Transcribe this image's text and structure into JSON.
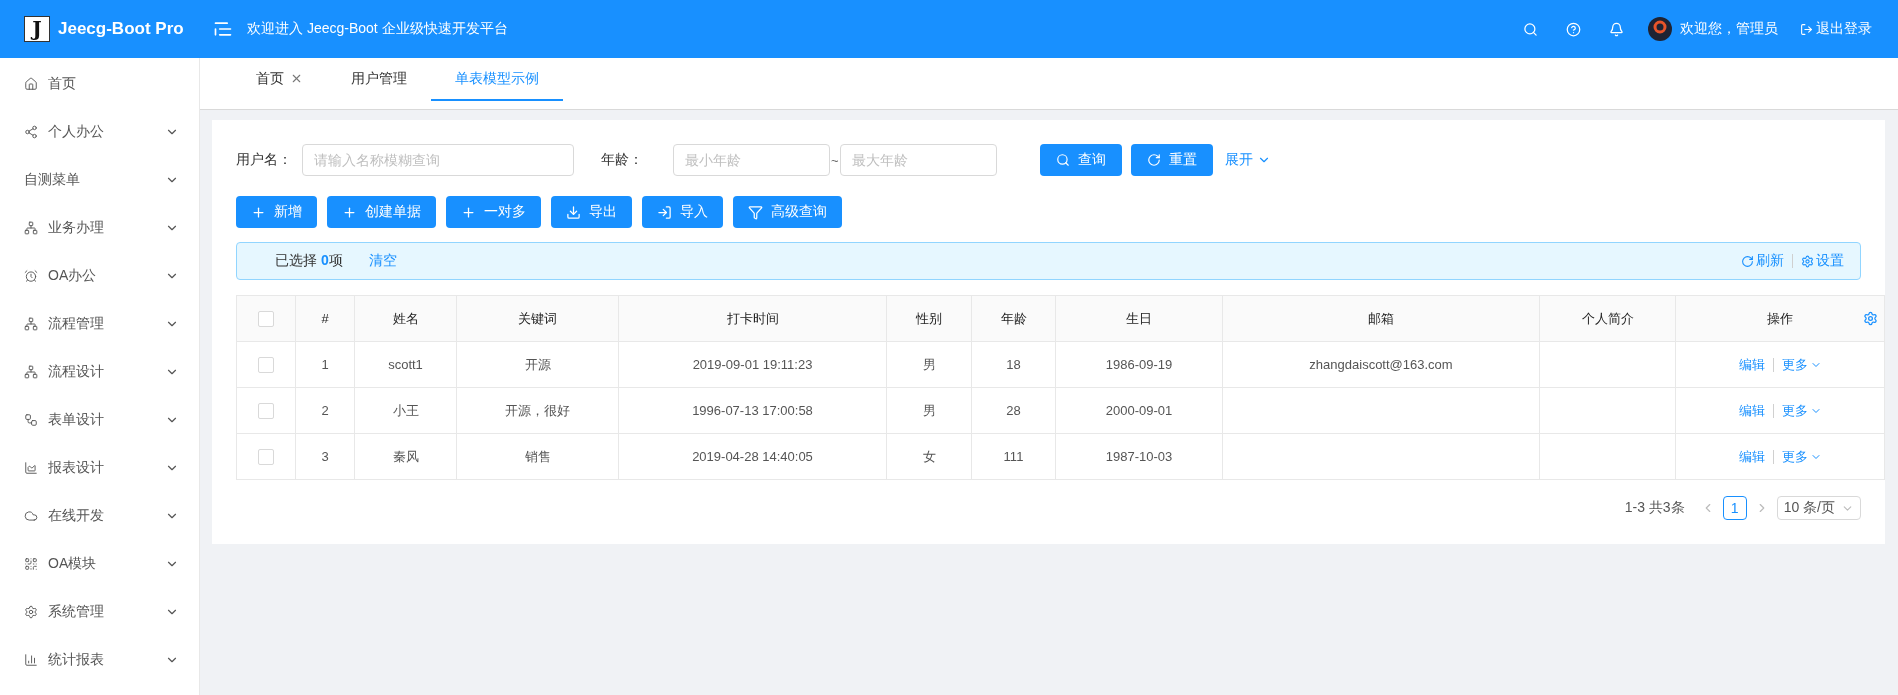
{
  "header": {
    "logo_mark": "J",
    "logo_text": "Jeecg-Boot Pro",
    "welcome": "欢迎进入 Jeecg-Boot 企业级快速开发平台",
    "user_name": "欢迎您，管理员",
    "logout": "退出登录"
  },
  "sidebar": {
    "items": [
      {
        "label": "首页",
        "kind": "home",
        "expandable": false
      },
      {
        "label": "个人办公",
        "kind": "share",
        "expandable": true
      },
      {
        "label": "自测菜单",
        "kind": "plain",
        "expandable": true
      },
      {
        "label": "业务办理",
        "kind": "sitemap",
        "expandable": true
      },
      {
        "label": "OA办公",
        "kind": "alarm",
        "expandable": true
      },
      {
        "label": "流程管理",
        "kind": "sitemap",
        "expandable": true
      },
      {
        "label": "流程设计",
        "kind": "sitemap",
        "expandable": true
      },
      {
        "label": "表单设计",
        "kind": "cluster",
        "expandable": true
      },
      {
        "label": "报表设计",
        "kind": "area",
        "expandable": true
      },
      {
        "label": "在线开发",
        "kind": "cloud",
        "expandable": true
      },
      {
        "label": "OA模块",
        "kind": "qrcode",
        "expandable": true
      },
      {
        "label": "系统管理",
        "kind": "gear",
        "expandable": true
      },
      {
        "label": "统计报表",
        "kind": "bar",
        "expandable": true
      }
    ]
  },
  "tabs": [
    {
      "label": "首页",
      "selected": false,
      "closable": true
    },
    {
      "label": "用户管理",
      "selected": false,
      "closable": false
    },
    {
      "label": "单表模型示例",
      "selected": true,
      "closable": false
    }
  ],
  "search": {
    "username_label": "用户名：",
    "username_placeholder": "请输入名称模糊查询",
    "age_label": "年龄：",
    "age_min_placeholder": "最小年龄",
    "age_separator": "~",
    "age_max_placeholder": "最大年龄",
    "query": "查询",
    "reset": "重置",
    "expand": "展开"
  },
  "toolbar": [
    {
      "label": "新增",
      "kind": "plus"
    },
    {
      "label": "创建单据",
      "kind": "plus"
    },
    {
      "label": "一对多",
      "kind": "plus"
    },
    {
      "label": "导出",
      "kind": "download"
    },
    {
      "label": "导入",
      "kind": "import"
    },
    {
      "label": "高级查询",
      "kind": "filter"
    }
  ],
  "alert": {
    "selected_text": "已选择 **0**项",
    "clear": "清空",
    "refresh": "刷新",
    "settings": "设置"
  },
  "table": {
    "header_checked": false,
    "columns": [
      "#",
      "姓名",
      "关键词",
      "打卡时间",
      "性别",
      "年龄",
      "生日",
      "邮箱",
      "个人简介",
      "操作"
    ],
    "rows": [
      {
        "checked": false,
        "cells": [
          "1",
          "scott1",
          "开源",
          "2019-09-01 19:11:23",
          "男",
          "18",
          "1986-09-19",
          "zhangdaiscott@163.com",
          ""
        ],
        "actions": [
          "编辑",
          "更多"
        ]
      },
      {
        "checked": false,
        "cells": [
          "2",
          "小王",
          "开源，很好",
          "1996-07-13 17:00:58",
          "男",
          "28",
          "2000-09-01",
          "",
          ""
        ],
        "actions": [
          "编辑",
          "更多"
        ]
      },
      {
        "checked": false,
        "cells": [
          "3",
          "秦风",
          "销售",
          "2019-04-28 14:40:05",
          "女",
          "111",
          "1987-10-03",
          "",
          ""
        ],
        "actions": [
          "编辑",
          "更多"
        ]
      }
    ]
  },
  "pagination": {
    "summary": "1-3 共3条",
    "pages": [
      {
        "label": "1",
        "selected": true
      }
    ],
    "page_size": "10 条/页"
  }
}
